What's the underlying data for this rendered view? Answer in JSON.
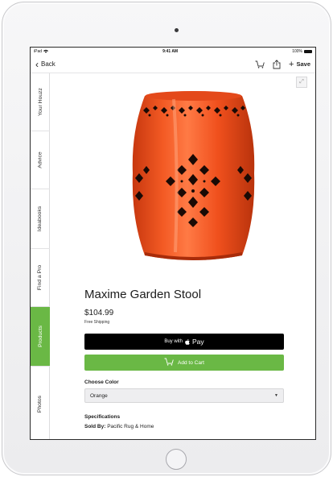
{
  "status_bar": {
    "carrier": "iPad",
    "time": "9:41 AM",
    "battery": "100%"
  },
  "nav": {
    "back_label": "Back",
    "save_label": "Save"
  },
  "side_tabs": [
    {
      "label": "Your Houzz",
      "active": false
    },
    {
      "label": "Advice",
      "active": false
    },
    {
      "label": "Ideabooks",
      "active": false
    },
    {
      "label": "Find a Pro",
      "active": false
    },
    {
      "label": "Products",
      "active": true
    },
    {
      "label": "Photos",
      "active": false
    }
  ],
  "product": {
    "title": "Maxime Garden Stool",
    "price": "$104.99",
    "shipping": "Free Shipping",
    "image_icon": "orange-ceramic-garden-stool"
  },
  "buttons": {
    "buy_with": "Buy with",
    "pay": "Pay",
    "add_to_cart": "Add to Cart"
  },
  "options": {
    "choose_color_label": "Choose Color",
    "selected_color": "Orange"
  },
  "specifications": {
    "heading": "Specifications",
    "sold_by_label": "Sold By:",
    "sold_by_value": "Pacific Rug & Home"
  },
  "colors": {
    "accent_green": "#6ab845",
    "stool_orange": "#f0501d",
    "apple_pay_black": "#000000"
  }
}
